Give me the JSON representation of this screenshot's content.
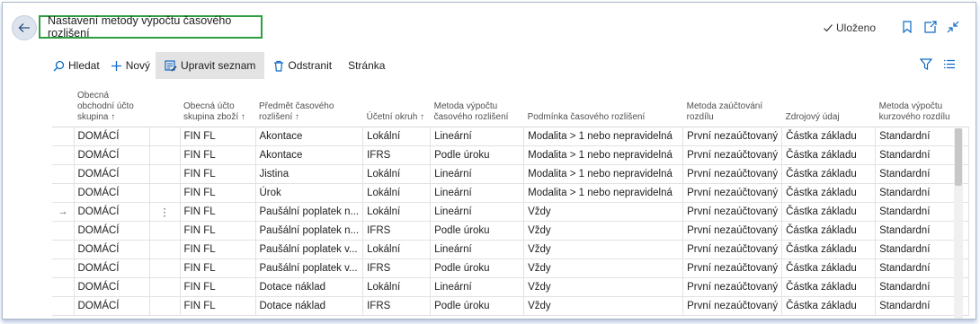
{
  "header": {
    "title": "Nastavení metody výpočtu časového rozlišení",
    "saved_label": "Uloženo"
  },
  "toolbar": {
    "search_label": "Hledat",
    "new_label": "Nový",
    "edit_list_label": "Upravit seznam",
    "delete_label": "Odstranit",
    "page_label": "Stránka"
  },
  "table": {
    "headers": [
      "Obecná obchodní účto skupina ↑",
      "Obecná účto skupina zboží ↑",
      "Předmět časového rozlišení ↑",
      "Účetní okruh ↑",
      "Metoda výpočtu časového rozlišení",
      "Podmínka časového rozlišení",
      "Metoda zaúčtování rozdílu",
      "Zdrojový údaj",
      "Metoda výpočtu kurzového rozdílu"
    ],
    "rows": [
      [
        "DOMÁCÍ",
        "FIN FL",
        "Akontace",
        "Lokální",
        "Lineární",
        "Modalita > 1 nebo nepravidelná",
        "První nezaúčtovaný",
        "Částka základu",
        "Standardní"
      ],
      [
        "DOMÁCÍ",
        "FIN FL",
        "Akontace",
        "IFRS",
        "Podle úroku",
        "Modalita > 1 nebo nepravidelná",
        "První nezaúčtovaný",
        "Částka základu",
        "Standardní"
      ],
      [
        "DOMÁCÍ",
        "FIN FL",
        "Jistina",
        "Lokální",
        "Lineární",
        "Modalita > 1 nebo nepravidelná",
        "První nezaúčtovaný",
        "Částka základu",
        "Standardní"
      ],
      [
        "DOMÁCÍ",
        "FIN FL",
        "Úrok",
        "Lokální",
        "Lineární",
        "Modalita > 1 nebo nepravidelná",
        "První nezaúčtovaný",
        "Částka základu",
        "Standardní"
      ],
      [
        "DOMÁCÍ",
        "FIN FL",
        "Paušální poplatek n...",
        "Lokální",
        "Lineární",
        "Vždy",
        "První nezaúčtovaný",
        "Částka základu",
        "Standardní"
      ],
      [
        "DOMÁCÍ",
        "FIN FL",
        "Paušální poplatek n...",
        "IFRS",
        "Podle úroku",
        "Vždy",
        "První nezaúčtovaný",
        "Částka základu",
        "Standardní"
      ],
      [
        "DOMÁCÍ",
        "FIN FL",
        "Paušální poplatek v...",
        "Lokální",
        "Lineární",
        "Vždy",
        "První nezaúčtovaný",
        "Částka základu",
        "Standardní"
      ],
      [
        "DOMÁCÍ",
        "FIN FL",
        "Paušální poplatek v...",
        "IFRS",
        "Podle úroku",
        "Vždy",
        "První nezaúčtovaný",
        "Částka základu",
        "Standardní"
      ],
      [
        "DOMÁCÍ",
        "FIN FL",
        "Dotace náklad",
        "Lokální",
        "Lineární",
        "Vždy",
        "První nezaúčtovaný",
        "Částka základu",
        "Standardní"
      ],
      [
        "DOMÁCÍ",
        "FIN FL",
        "Dotace náklad",
        "IFRS",
        "Podle úroku",
        "Vždy",
        "První nezaúčtovaný",
        "Částka základu",
        "Standardní"
      ]
    ],
    "selected_row_marker": "→",
    "row_menu_glyph": "⋮"
  },
  "colors": {
    "accent": "#0e6ac7",
    "highlight_border": "#2e9e3e",
    "button_active_bg": "#e3e3e3"
  },
  "icons": [
    "back-arrow-icon",
    "checkmark-icon",
    "bookmark-icon",
    "open-new-window-icon",
    "collapse-icon",
    "search-icon",
    "plus-icon",
    "edit-list-icon",
    "trash-icon",
    "filter-icon",
    "list-view-icon",
    "row-menu-icon"
  ]
}
